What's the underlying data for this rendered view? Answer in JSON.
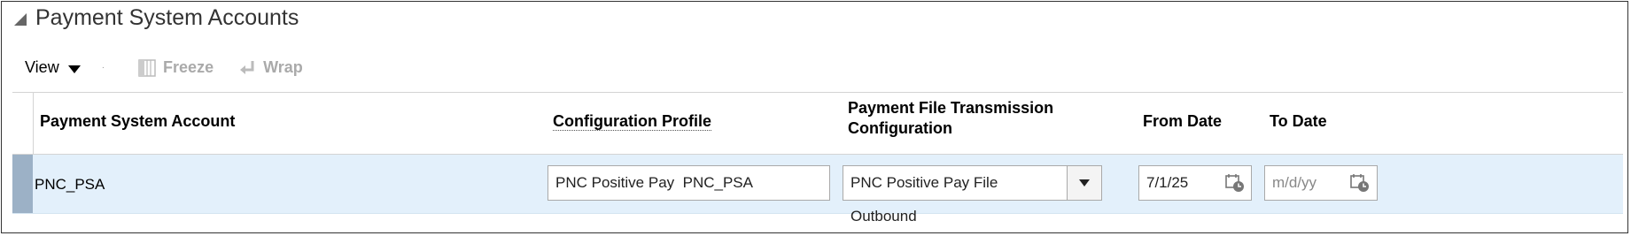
{
  "panel": {
    "title": "Payment System Accounts"
  },
  "toolbar": {
    "view_label": "View",
    "freeze_label": "Freeze",
    "wrap_label": "Wrap"
  },
  "columns": {
    "payment_system_account": "Payment System Account",
    "configuration_profile": "Configuration Profile",
    "transmission_line1": "Payment File Transmission",
    "transmission_line2": "Configuration",
    "from_date": "From Date",
    "to_date": "To Date"
  },
  "rows": [
    {
      "payment_system_account": "PNC_PSA",
      "configuration_profile": "PNC Positive Pay  PNC_PSA",
      "transmission_configuration": "PNC Positive Pay File Outbound",
      "from_date": "7/1/25",
      "to_date_placeholder": "m/d/yy"
    }
  ],
  "icons": {
    "collapse": "triangle-collapse-icon",
    "view_dropdown": "chevron-down-icon",
    "freeze": "freeze-columns-icon",
    "wrap": "wrap-text-icon",
    "select_dropdown": "chevron-down-icon",
    "calendar": "calendar-icon"
  },
  "colors": {
    "selected_row_bg": "#e3f0fb",
    "row_marker": "#9cb1c6",
    "disabled_text": "#aaaaaa"
  }
}
